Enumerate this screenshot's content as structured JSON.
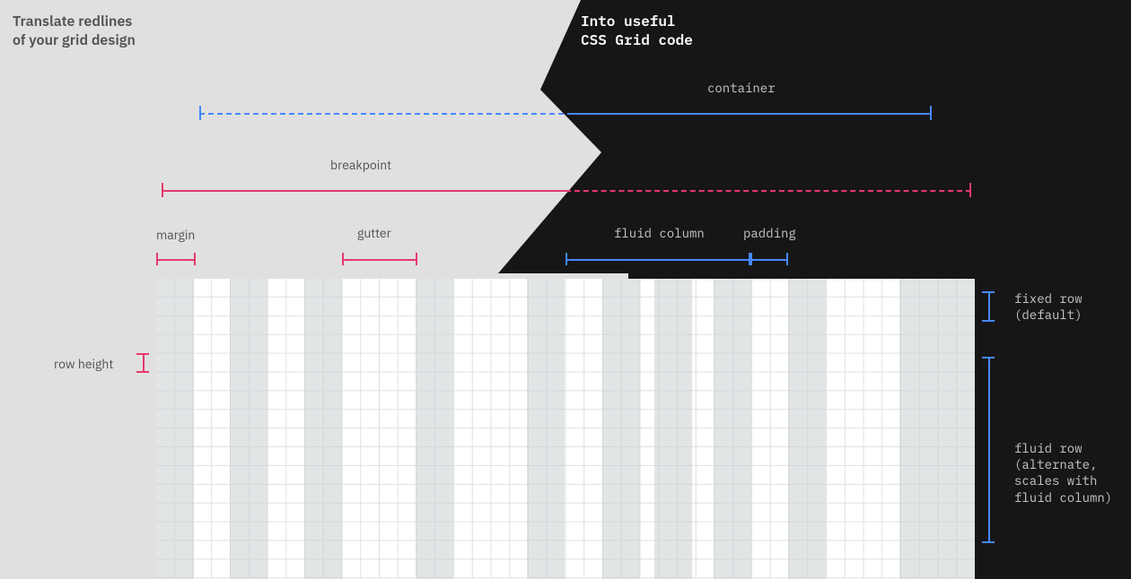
{
  "headings": {
    "left_line1": "Translate redlines",
    "left_line2": "of your grid design",
    "right_line1": "Into useful",
    "right_line2": "CSS Grid code"
  },
  "labels": {
    "container": "container",
    "breakpoint": "breakpoint",
    "margin": "margin",
    "gutter": "gutter",
    "fluid_column": "fluid column",
    "padding": "padding",
    "row_height": "row height",
    "fixed_row_l1": "fixed row",
    "fixed_row_l2": "(default)",
    "fluid_row_l1": "fluid row",
    "fluid_row_l2": "(alternate,",
    "fluid_row_l3": "scales with",
    "fluid_row_l4": "fluid column)"
  },
  "colors": {
    "blue": "#4589ff",
    "pink": "#e5396b",
    "light_bg": "#e0e0e0",
    "dark_bg": "#161616",
    "grid_overlay": "#ccd4d6"
  },
  "grid": {
    "columns": 8,
    "margin_cells": 2,
    "gutter_cells": 2,
    "column_cells_approx": 5
  }
}
